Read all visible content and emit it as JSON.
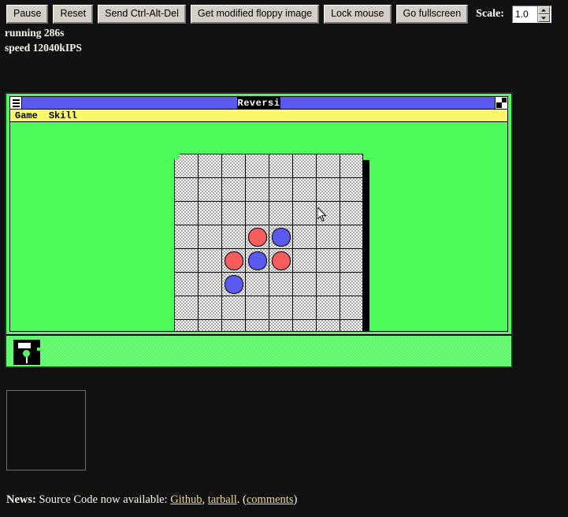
{
  "toolbar": {
    "buttons": [
      {
        "label": "Pause",
        "name": "pause-button"
      },
      {
        "label": "Reset",
        "name": "reset-button"
      },
      {
        "label": "Send Ctrl-Alt-Del",
        "name": "send-ctrl-alt-del-button"
      },
      {
        "label": "Get modified floppy image",
        "name": "get-floppy-image-button"
      },
      {
        "label": "Lock mouse",
        "name": "lock-mouse-button"
      },
      {
        "label": "Go fullscreen",
        "name": "go-fullscreen-button"
      }
    ],
    "scale_label": "Scale:",
    "scale_value": "1.0"
  },
  "status": {
    "running": "running 286s",
    "speed": "speed 12040kIPS"
  },
  "emulator": {
    "window": {
      "title": "Reversi",
      "sysmenu_icon": "hamburger-menu-icon",
      "maximize_icon": "maximize-icon",
      "menus": [
        {
          "label": "Game",
          "name": "menu-game"
        },
        {
          "label": "Skill",
          "name": "menu-skill"
        }
      ]
    },
    "board": {
      "rows": 8,
      "cols": 8,
      "piece_colors": {
        "red": "#f85c5c",
        "blue": "#5a5af0"
      },
      "board_color": "#a8a8a8",
      "desktop_color": "#4dfb5b",
      "pieces": [
        {
          "row": 3,
          "col": 3,
          "color": "red"
        },
        {
          "row": 3,
          "col": 4,
          "color": "blue"
        },
        {
          "row": 4,
          "col": 2,
          "color": "red"
        },
        {
          "row": 4,
          "col": 3,
          "color": "blue"
        },
        {
          "row": 4,
          "col": 4,
          "color": "red"
        },
        {
          "row": 5,
          "col": 2,
          "color": "blue"
        }
      ]
    },
    "taskbar": {
      "icon_name": "minimized-program-icon"
    }
  },
  "log": {
    "content": ""
  },
  "news": {
    "prefix": "News:",
    "text": "Source Code now available:",
    "link_github": "Github",
    "separator": ",",
    "link_tarball": "tarball",
    "period": ".",
    "open_paren": "(",
    "link_comments": "comments",
    "close_paren": ")"
  }
}
